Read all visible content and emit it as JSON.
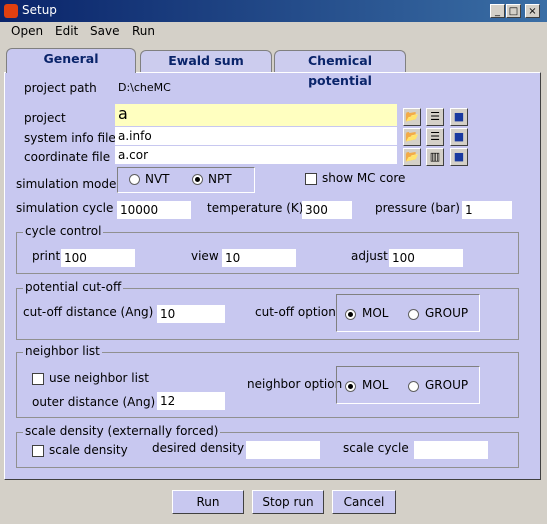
{
  "window": {
    "title": "Setup"
  },
  "menu": [
    "Open",
    "Edit",
    "Save",
    "Run"
  ],
  "tabs": [
    "General",
    "Ewald sum",
    "Chemical potential"
  ],
  "general": {
    "project_path_label": "project path",
    "project_path_value": "D:\\cheMC",
    "project_label": "project",
    "project_value": "a",
    "sysinfo_label": "system info file",
    "sysinfo_value": "a.info",
    "coord_label": "coordinate file",
    "coord_value": "a.cor",
    "sim_mode_label": "simulation mode",
    "sim_mode_options": [
      "NVT",
      "NPT"
    ],
    "sim_mode_selected": "NPT",
    "show_mc_core_label": "show MC core",
    "sim_cycle_label": "simulation cycle",
    "sim_cycle_value": "10000",
    "temperature_label": "temperature (K)",
    "temperature_value": "300",
    "pressure_label": "pressure (bar)",
    "pressure_value": "1"
  },
  "cycle_control": {
    "title": "cycle control",
    "print_label": "print",
    "print_value": "100",
    "view_label": "view",
    "view_value": "10",
    "adjust_label": "adjust",
    "adjust_value": "100"
  },
  "cutoff": {
    "title": "potential cut-off",
    "distance_label": "cut-off distance (Ang)",
    "distance_value": "10",
    "option_label": "cut-off option",
    "options": [
      "MOL",
      "GROUP"
    ],
    "selected": "MOL"
  },
  "neighbor": {
    "title": "neighbor list",
    "use_label": "use neighbor list",
    "outer_label": "outer distance (Ang)",
    "outer_value": "12",
    "option_label": "neighbor option",
    "options": [
      "MOL",
      "GROUP"
    ],
    "selected": "MOL"
  },
  "scale": {
    "title": "scale density (externally forced)",
    "check_label": "scale density",
    "desired_label": "desired density",
    "desired_value": "",
    "cycle_label": "scale cycle",
    "cycle_value": ""
  },
  "buttons": {
    "run": "Run",
    "stop": "Stop run",
    "cancel": "Cancel"
  }
}
